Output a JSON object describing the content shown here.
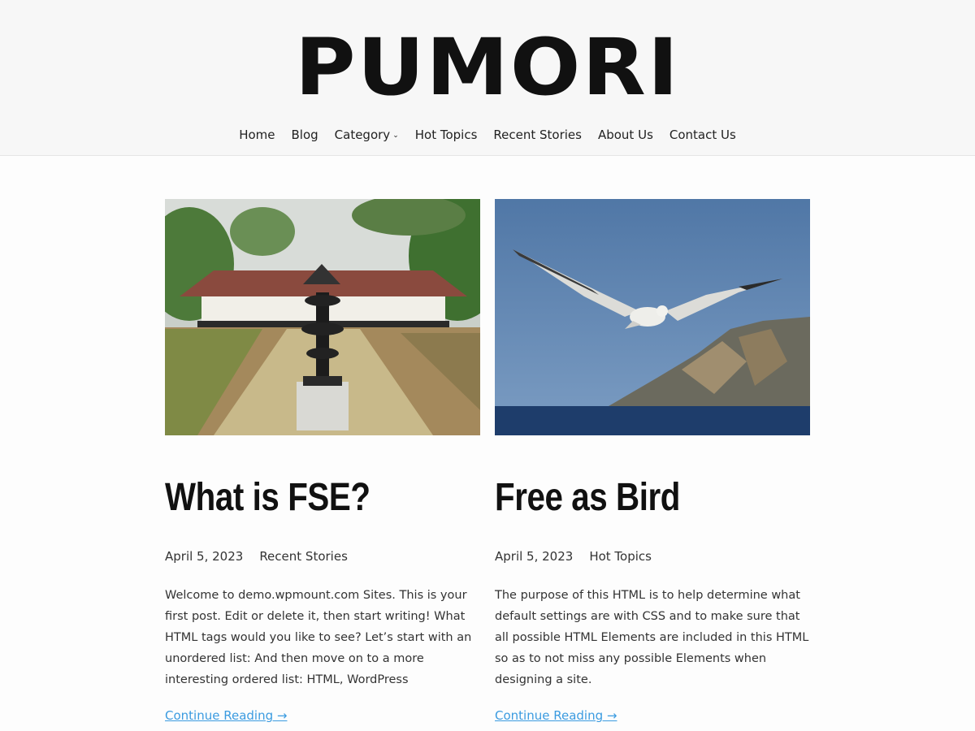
{
  "site": {
    "title": "PUMORI"
  },
  "nav": {
    "items": [
      {
        "label": "Home"
      },
      {
        "label": "Blog"
      },
      {
        "label": "Category"
      },
      {
        "label": "Hot Topics"
      },
      {
        "label": "Recent Stories"
      },
      {
        "label": "About Us"
      },
      {
        "label": "Contact Us"
      }
    ]
  },
  "posts": [
    {
      "title": "What is FSE?",
      "date": "April 5, 2023",
      "category": "Recent Stories",
      "excerpt": "Welcome to demo.wpmount.com Sites. This is your first post. Edit or delete it, then start writing! What HTML tags would you like to see? Let’s start with an unordered list: And then move on to a more interesting ordered list: HTML, WordPress",
      "read_more": "Continue Reading →"
    },
    {
      "title": "Free as Bird",
      "date": "April 5, 2023",
      "category": "Hot Topics",
      "excerpt": "The purpose of this HTML is to help determine what default settings are with CSS and to make sure that all possible HTML Elements are included in this HTML so as to not miss any possible Elements when designing a site.",
      "read_more": "Continue Reading →"
    }
  ],
  "colors": {
    "link": "#3b9be0",
    "header_bg": "#f7f7f7",
    "text": "#222222"
  }
}
